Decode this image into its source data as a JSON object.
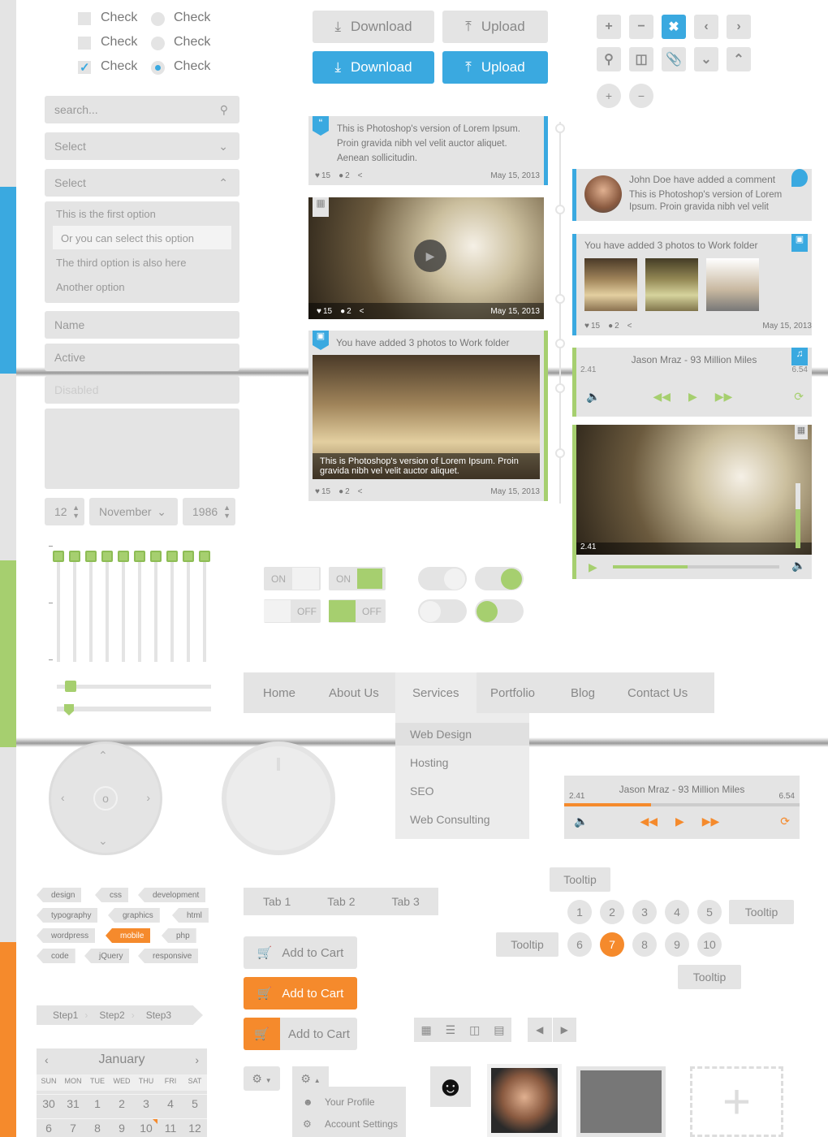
{
  "checks": {
    "label": "Check",
    "boxes": [
      false,
      false,
      true
    ],
    "radios": [
      false,
      false,
      true
    ]
  },
  "accent": {
    "blue": "#3aa9e0",
    "green": "#a6cf6f",
    "orange": "#f58a2c"
  },
  "form": {
    "search_placeholder": "search...",
    "select1": "Select",
    "select2": "Select",
    "options": [
      "This is the first option",
      "Or you can select this option",
      "The third option is also here",
      "Another option"
    ],
    "name_placeholder": "Name",
    "active_value": "Active",
    "disabled_value": "Disabled",
    "day": "12",
    "month": "November",
    "year": "1986"
  },
  "buttons": {
    "download": "Download",
    "upload": "Upload"
  },
  "icon_buttons": [
    "plus-icon",
    "minus-icon",
    "close-icon",
    "chevron-left-icon",
    "chevron-right-icon",
    "search-icon",
    "trash-icon",
    "paperclip-icon",
    "chevron-down-icon",
    "chevron-up-icon"
  ],
  "timeline": {
    "quote": {
      "text": "This is Photoshop's version  of Lorem Ipsum. Proin gravida nibh vel velit auctor aliquet. Aenean sollicitudin.",
      "likes": "15",
      "comments": "2",
      "date": "May 15, 2013"
    },
    "video": {
      "likes": "15",
      "comments": "2",
      "date": "May 15, 2013"
    },
    "gallery": {
      "title": "You have added 3 photos to Work folder",
      "caption": "This is Photoshop's version  of Lorem Ipsum. Proin gravida nibh vel velit auctor aliquet.",
      "likes": "15",
      "comments": "2",
      "date": "May 15, 2013"
    }
  },
  "feed": {
    "comment": {
      "title": "John Doe have added a comment",
      "text": "This is Photoshop's version  of Lorem Ipsum. Proin gravida nibh vel velit"
    },
    "photos": {
      "title": "You have added 3 photos to Work folder",
      "likes": "15",
      "comments": "2",
      "date": "May 15, 2013"
    },
    "audio": {
      "title": "Jason Mraz  -  93 Million Miles",
      "elapsed": "2.41",
      "total": "6.54"
    },
    "video": {
      "elapsed": "2.41",
      "progress": 0.45,
      "volume": 0.6
    }
  },
  "toggles": {
    "on": "ON",
    "off": "OFF"
  },
  "nav": {
    "items": [
      "Home",
      "About Us",
      "Services",
      "Portfolio",
      "Blog",
      "Contact Us"
    ],
    "active": "Services",
    "dropdown": [
      "Web Design",
      "Hosting",
      "SEO",
      "Web Consulting"
    ]
  },
  "audio2": {
    "title": "Jason Mraz  -  93 Million Miles",
    "elapsed": "2.41",
    "total": "6.54",
    "progress": 0.37
  },
  "tags": [
    "design",
    "css",
    "development",
    "typography",
    "graphics",
    "html",
    "wordpress",
    "mobile",
    "php",
    "code",
    "jQuery",
    "responsive"
  ],
  "active_tag": "mobile",
  "tabs": [
    "Tab 1",
    "Tab 2",
    "Tab 3"
  ],
  "cart": {
    "label": "Add to Cart"
  },
  "tooltip": "Tooltip",
  "pagination": {
    "pages": [
      "1",
      "2",
      "3",
      "4",
      "5",
      "6",
      "7",
      "8",
      "9",
      "10"
    ],
    "current": "7"
  },
  "steps": [
    "Step1",
    "Step2",
    "Step3"
  ],
  "calendar": {
    "month": "January",
    "days": [
      "SUN",
      "MON",
      "TUE",
      "WED",
      "THU",
      "FRI",
      "SAT"
    ],
    "rows": [
      [
        "30",
        "31",
        "1",
        "2",
        "3",
        "4",
        "5"
      ],
      [
        "6",
        "7",
        "8",
        "9",
        "10",
        "11",
        "12"
      ]
    ]
  },
  "user_menu": {
    "items": [
      "Your Profile",
      "Account Settings"
    ]
  }
}
